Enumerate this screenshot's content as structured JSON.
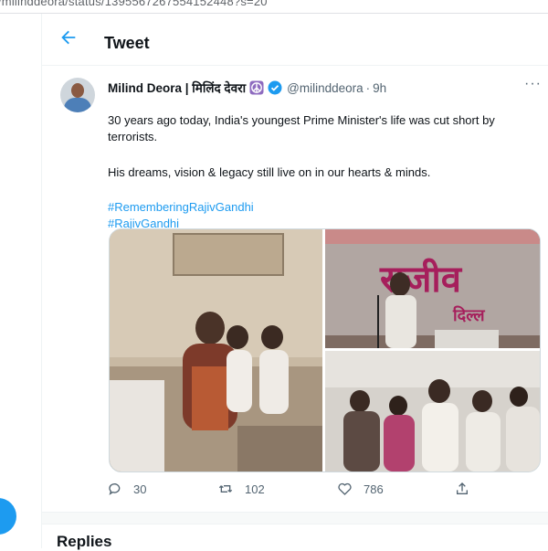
{
  "browser": {
    "url": "/milinddeora/status/1395567267554152448?s=20"
  },
  "header": {
    "title": "Tweet",
    "back_icon": "arrow-left-icon"
  },
  "tweet": {
    "author_name": "Milind Deora | मिलिंद देवरा",
    "handle": "@milinddeora",
    "separator": "·",
    "time": "9h",
    "more": "···",
    "line1": "30 years ago today, India's youngest Prime Minister's life was cut short by terrorists.",
    "line2": "His dreams, vision & legacy still live on in our hearts & minds.",
    "hashtag1": "#RememberingRajivGandhi",
    "hashtag2": "#RajivGandhi",
    "photo2_sign_top": "राजीव",
    "photo2_sign_bottom": "दिल्ल"
  },
  "actions": {
    "replies": "30",
    "retweets": "102",
    "likes": "786"
  },
  "section": {
    "title": "Replies"
  },
  "colors": {
    "accent": "#1d9bf0",
    "muted": "#536471",
    "peace_badge": "#8e6bbf"
  }
}
